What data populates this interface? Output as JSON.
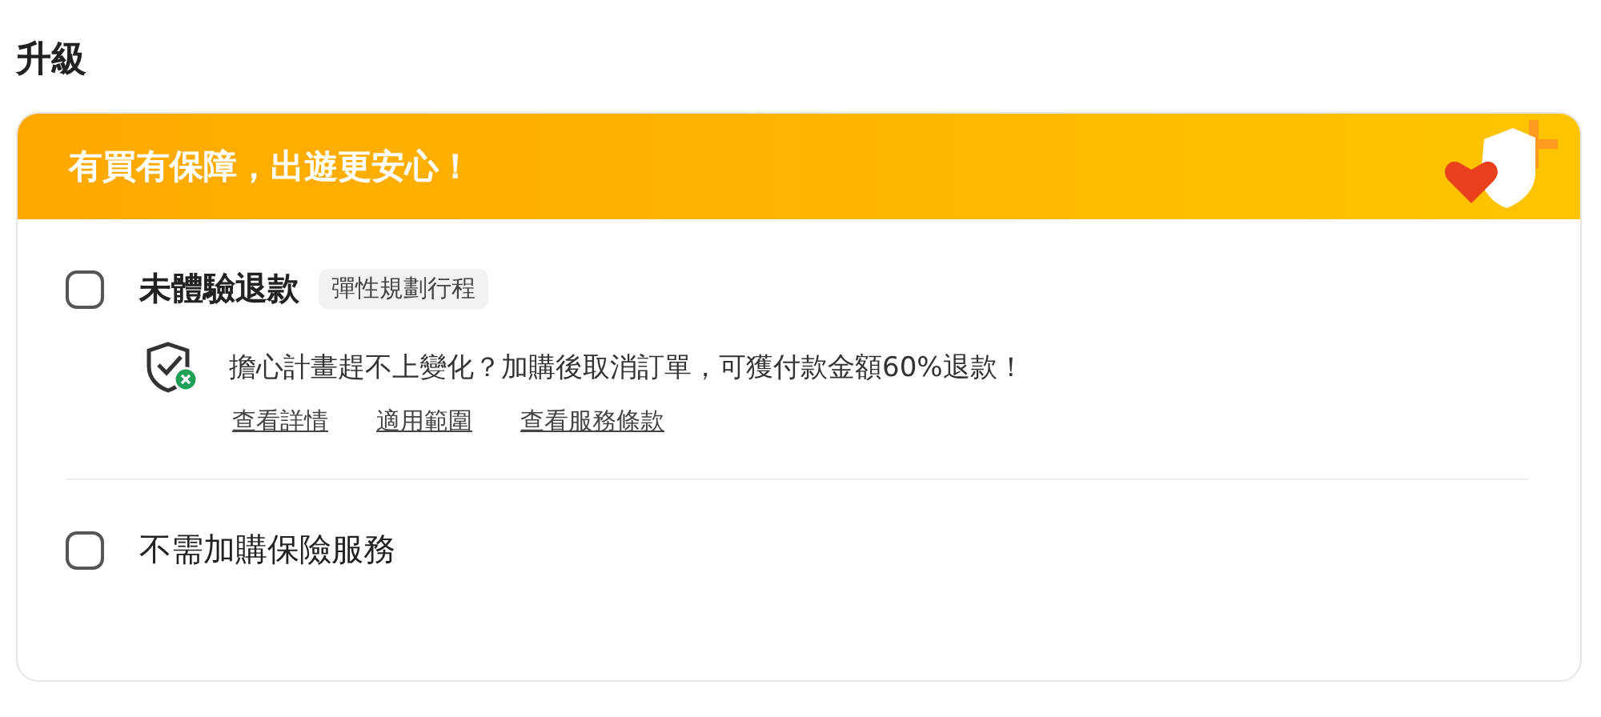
{
  "section_title": "升級",
  "banner": {
    "text": "有買有保障，出遊更安心！"
  },
  "options": [
    {
      "kind": "plan",
      "label": "未體驗退款",
      "checked": false,
      "tag": "彈性規劃行程",
      "description": "擔心計畫趕不上變化？加購後取消訂單，可獲付款金額60%退款！",
      "links": [
        "查看詳情",
        "適用範圍",
        "查看服務條款"
      ]
    },
    {
      "kind": "decline",
      "label": "不需加購保險服務",
      "checked": false
    }
  ]
}
